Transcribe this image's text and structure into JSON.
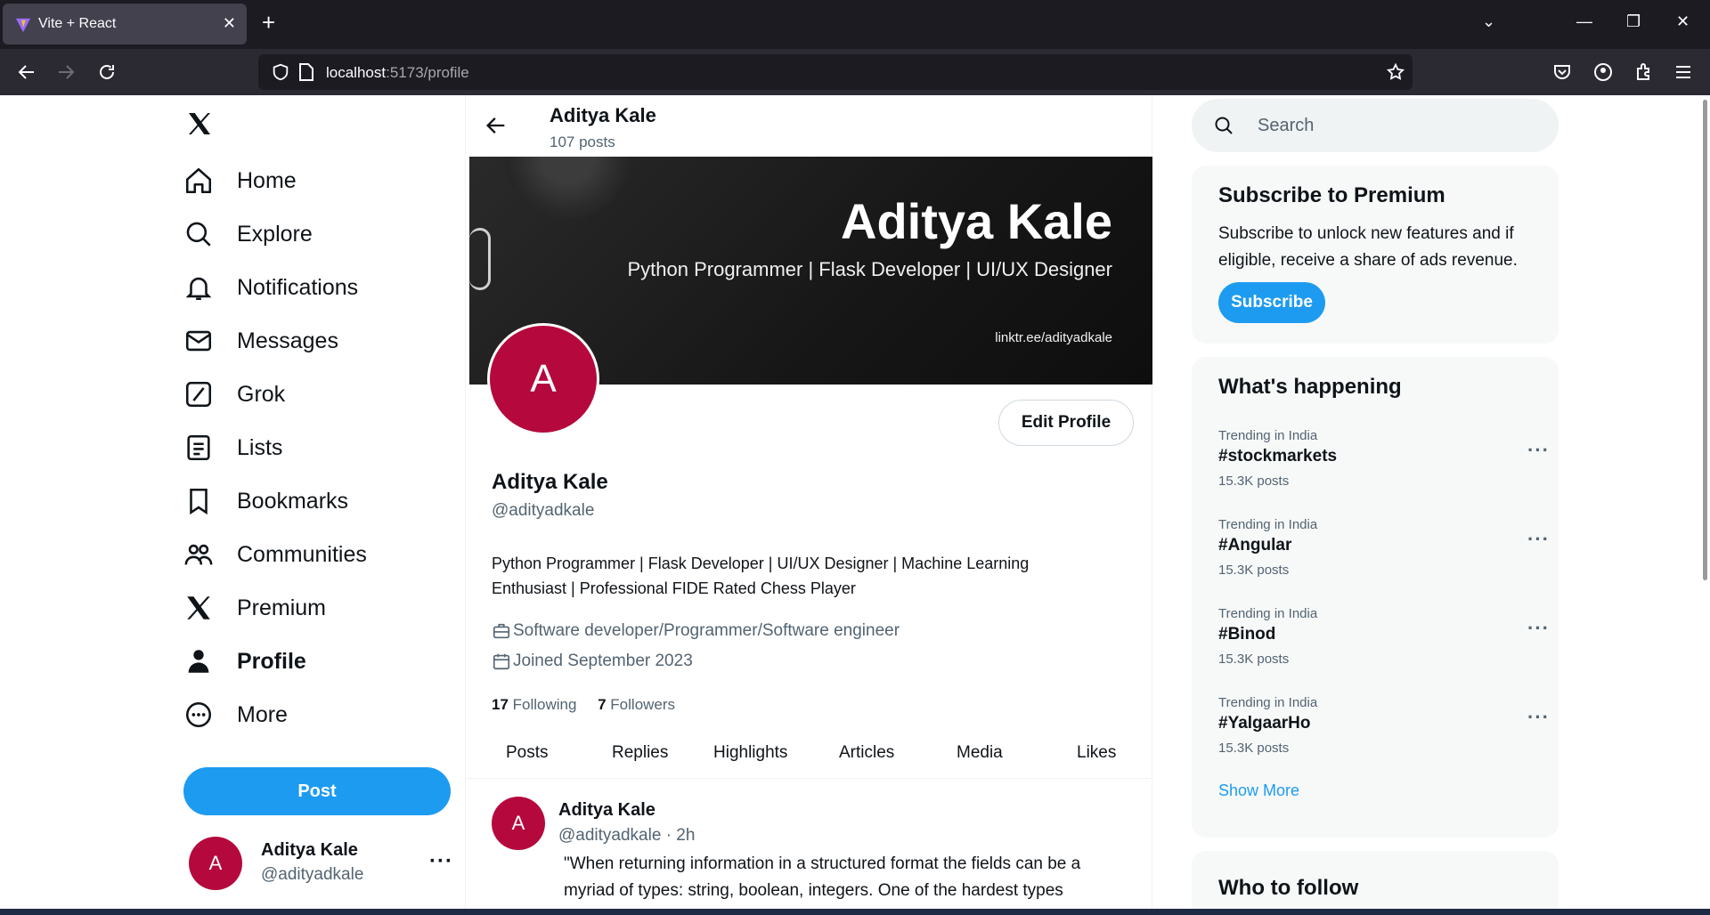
{
  "browser": {
    "tab_title": "Vite + React",
    "url_host": "localhost",
    "url_path": ":5173/profile"
  },
  "nav": {
    "items": [
      {
        "label": "Home",
        "icon": "home-icon"
      },
      {
        "label": "Explore",
        "icon": "search-icon"
      },
      {
        "label": "Notifications",
        "icon": "bell-icon"
      },
      {
        "label": "Messages",
        "icon": "mail-icon"
      },
      {
        "label": "Grok",
        "icon": "grok-icon"
      },
      {
        "label": "Lists",
        "icon": "list-icon"
      },
      {
        "label": "Bookmarks",
        "icon": "bookmark-icon"
      },
      {
        "label": "Communities",
        "icon": "communities-icon"
      },
      {
        "label": "Premium",
        "icon": "x-logo-icon"
      },
      {
        "label": "Profile",
        "icon": "person-icon"
      },
      {
        "label": "More",
        "icon": "more-circle-icon"
      }
    ],
    "post_label": "Post",
    "user_initial": "A",
    "user_name": "Aditya Kale",
    "user_handle": "@adityadkale"
  },
  "header": {
    "name": "Aditya Kale",
    "posts": "107 posts"
  },
  "banner": {
    "name": "Aditya Kale",
    "subtitle": "Python Programmer | Flask Developer | UI/UX Designer",
    "link": "linktr.ee/adityadkale"
  },
  "profile": {
    "initial": "A",
    "edit_label": "Edit Profile",
    "name": "Aditya Kale",
    "handle": "@adityadkale",
    "bio": "Python Programmer | Flask Developer | UI/UX Designer | Machine Learning Enthusiast | Professional FIDE Rated Chess Player",
    "job": "Software developer/Programmer/Software engineer",
    "joined": "Joined September 2023",
    "following_count": "17",
    "following_label": "Following",
    "followers_count": "7",
    "followers_label": "Followers"
  },
  "tabs": [
    "Posts",
    "Replies",
    "Highlights",
    "Articles",
    "Media",
    "Likes"
  ],
  "tweet": {
    "initial": "A",
    "name": "Aditya Kale",
    "handle_time": "@adityadkale · 2h",
    "text": "\"When returning information in a structured format the fields can be a myriad of types: string, boolean, integers. One of the hardest types"
  },
  "right": {
    "search_placeholder": "Search",
    "premium_title": "Subscribe to Premium",
    "premium_text": "Subscribe to unlock new features and if eligible, receive a share of ads revenue.",
    "subscribe_label": "Subscribe",
    "happening_title": "What's happening",
    "trends": [
      {
        "category": "Trending in India",
        "tag": "#stockmarkets",
        "count": "15.3K posts"
      },
      {
        "category": "Trending in India",
        "tag": "#Angular",
        "count": "15.3K posts"
      },
      {
        "category": "Trending in India",
        "tag": "#Binod",
        "count": "15.3K posts"
      },
      {
        "category": "Trending in India",
        "tag": "#YalgaarHo",
        "count": "15.3K posts"
      }
    ],
    "show_more": "Show More",
    "follow_title": "Who to follow"
  },
  "colors": {
    "accent": "#1d9bf0",
    "avatar": "#b5093e",
    "muted": "#536471"
  }
}
